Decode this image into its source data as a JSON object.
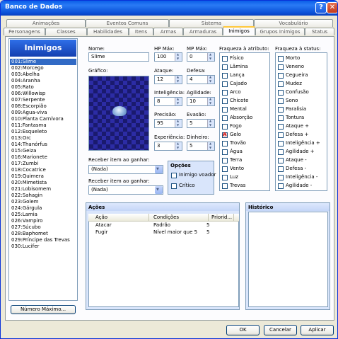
{
  "window": {
    "title": "Banco de Dados",
    "help_glyph": "?",
    "close_glyph": "✕"
  },
  "tabs_top": [
    "Animações",
    "Eventos Comuns",
    "Sistema",
    "Vocabulário"
  ],
  "tabs_bottom": [
    "Personagens",
    "Classes",
    "Habilidades",
    "Itens",
    "Armas",
    "Armaduras",
    "Inimigos",
    "Grupos Inimigos",
    "Status"
  ],
  "active_tab": "Inimigos",
  "list": {
    "header": "Inimigos",
    "selected": 0,
    "items": [
      "001:Slime",
      "002:Morcego",
      "003:Abelha",
      "004:Aranha",
      "005:Rato",
      "006:Willowisp",
      "007:Serpente",
      "008:Escorpião",
      "009:Água-viva",
      "010:Planta Carnívora",
      "011:Fantasma",
      "012:Esqueleto",
      "013:Orc",
      "014:Thanórfus",
      "015:Geiza",
      "016:Marionete",
      "017:Zumbi",
      "018:Cocatrice",
      "019:Quimera",
      "020:Mimetista",
      "021:Lobisomem",
      "022:Sahagin",
      "023:Golem",
      "024:Gárgula",
      "025:Lamia",
      "026:Vampiro",
      "027:Súcubo",
      "028:Baphomet",
      "029:Príncipe das Trevas",
      "030:Lucifer"
    ],
    "max_button": "Número Máximo..."
  },
  "form": {
    "name_label": "Nome:",
    "name_value": "Slime",
    "graphic_label": "Gráfico:",
    "hp_label": "HP Máx:",
    "hp_value": "100",
    "mp_label": "MP Máx:",
    "mp_value": "0",
    "atk_label": "Ataque:",
    "atk_value": "12",
    "def_label": "Defesa:",
    "def_value": "4",
    "int_label": "Inteligência:",
    "int_value": "8",
    "agi_label": "Agilidade:",
    "agi_value": "10",
    "acc_label": "Precisão:",
    "acc_value": "95",
    "eva_label": "Evasão:",
    "eva_value": "5",
    "exp_label": "Experiência:",
    "exp_value": "3",
    "gold_label": "Dinheiro:",
    "gold_value": "5",
    "item1_label": "Receber item ao ganhar:",
    "item1_value": "(Nada)",
    "item2_label": "Receber item ao ganhar:",
    "item2_value": "(Nada)",
    "options_label": "Opções",
    "flying_label": "Inimigo voador",
    "critical_label": "Crítico"
  },
  "elements": {
    "label": "Fraqueza à atributo:",
    "items": [
      "Físico",
      "Lâmina",
      "Lança",
      "Cajado",
      "Arco",
      "Chicote",
      "Mental",
      "Absorção",
      "Fogo",
      "Gelo",
      "Trovão",
      "Água",
      "Terra",
      "Vento",
      "Luz",
      "Trevas"
    ],
    "rune": "A",
    "rune_index": 9
  },
  "states": {
    "label": "Fraqueza à status:",
    "items": [
      "Morto",
      "Veneno",
      "Cegueira",
      "Mudez",
      "Confusão",
      "Sono",
      "Paralisia",
      "Tontura",
      "Ataque +",
      "Defesa +",
      "Inteligência +",
      "Agilidade +",
      "Ataque -",
      "Defesa -",
      "Inteligência -",
      "Agilidade -"
    ]
  },
  "actions": {
    "label": "Ações",
    "columns": [
      "Ação",
      "Condições",
      "Priorid..."
    ],
    "rows": [
      [
        "Atacar",
        "Padrão",
        "5"
      ],
      [
        "Fugir",
        "Nível maior que 5",
        "5"
      ]
    ]
  },
  "history": {
    "label": "Histórico"
  },
  "buttons": {
    "ok": "OK",
    "cancel": "Cancelar",
    "apply": "Aplicar"
  },
  "colors": {
    "selection": "#316ac5",
    "title_bar": "#0a5ee8",
    "active_tab_accent": "#ffc83c"
  }
}
